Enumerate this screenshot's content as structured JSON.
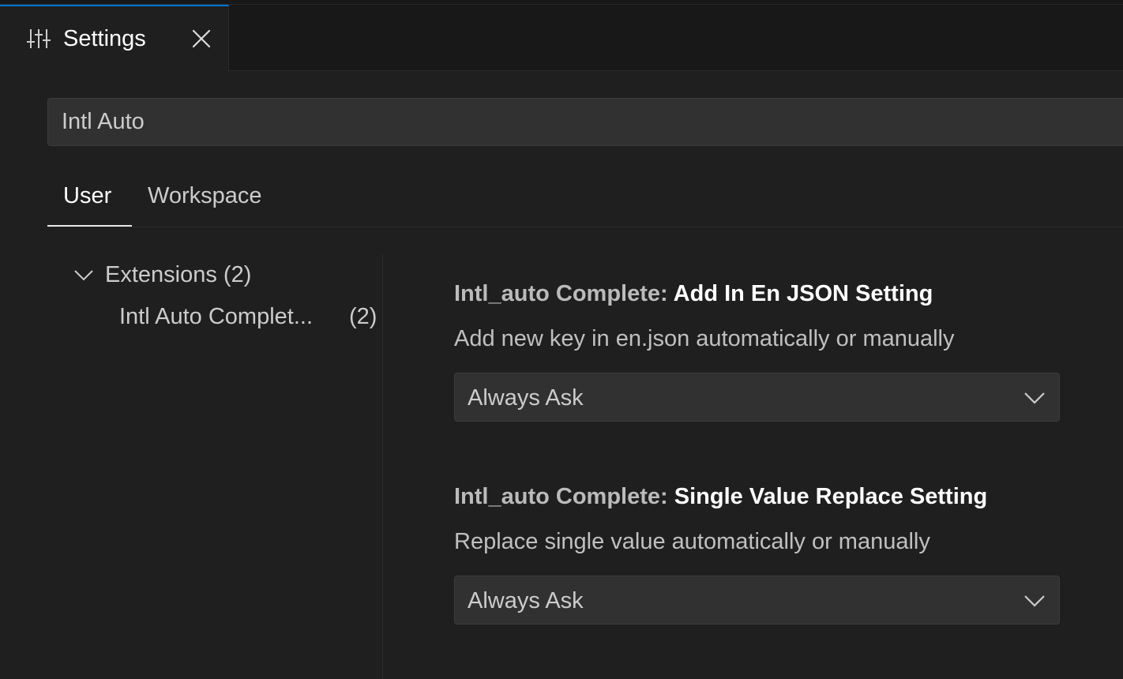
{
  "tab": {
    "title": "Settings",
    "icon": "settings-sliders-icon",
    "close_icon": "close-icon"
  },
  "search": {
    "value": "Intl Auto"
  },
  "scope_tabs": [
    {
      "label": "User",
      "active": true
    },
    {
      "label": "Workspace",
      "active": false
    }
  ],
  "tree": {
    "group": {
      "label": "Extensions",
      "count": "(2)",
      "expanded": true
    },
    "child": {
      "label": "Intl Auto Complet...",
      "count": "(2)"
    }
  },
  "settings": [
    {
      "category": "Intl_auto Complete: ",
      "name": "Add In En JSON Setting",
      "description": "Add new key in en.json automatically or manually",
      "value": "Always Ask"
    },
    {
      "category": "Intl_auto Complete: ",
      "name": "Single Value Replace Setting",
      "description": "Replace single value automatically or manually",
      "value": "Always Ask"
    }
  ],
  "colors": {
    "accent": "#0078d4",
    "background": "#1f1f1f",
    "input_background": "#313131"
  }
}
